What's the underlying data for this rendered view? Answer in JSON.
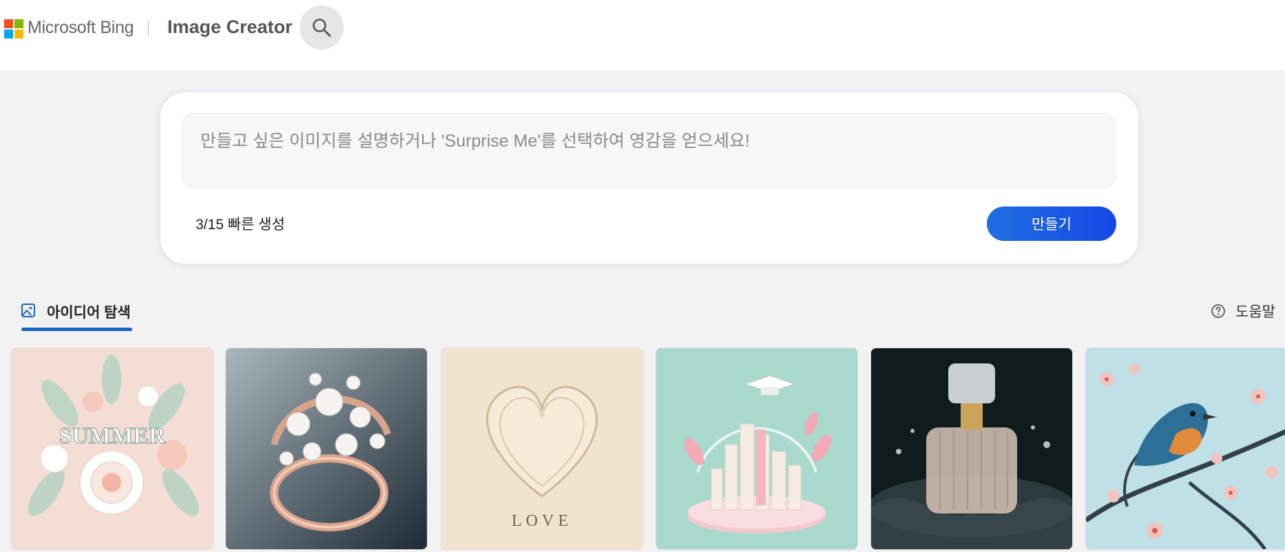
{
  "header": {
    "brand": "Microsoft Bing",
    "app_title": "Image Creator",
    "search_icon": "search-icon",
    "logo_colors": [
      "#f25022",
      "#7fba00",
      "#00a4ef",
      "#ffb900"
    ]
  },
  "prompt": {
    "placeholder": "만들고 싶은 이미지를 설명하거나 'Surprise Me'를 선택하여 영감을 얻으세요!",
    "value": "",
    "boosts": "3/15 빠른 생성",
    "create_label": "만들기"
  },
  "tabs": {
    "explore_label": "아이디어 탐색",
    "explore_icon": "image-icon"
  },
  "help": {
    "label": "도움말",
    "icon": "help-circle-icon"
  },
  "gallery": {
    "items": [
      {
        "text": "SUMMER",
        "subject": "paper flowers"
      },
      {
        "subject": "pearl ring"
      },
      {
        "text": "LOVE",
        "subject": "paper heart"
      },
      {
        "subject": "graduation city"
      },
      {
        "subject": "perfume bottle"
      },
      {
        "subject": "bird on blossom branch"
      }
    ]
  },
  "colors": {
    "accent": "#1f6fe0",
    "tab_underline": "#1564c0",
    "page_bg": "#f2f2f2"
  }
}
